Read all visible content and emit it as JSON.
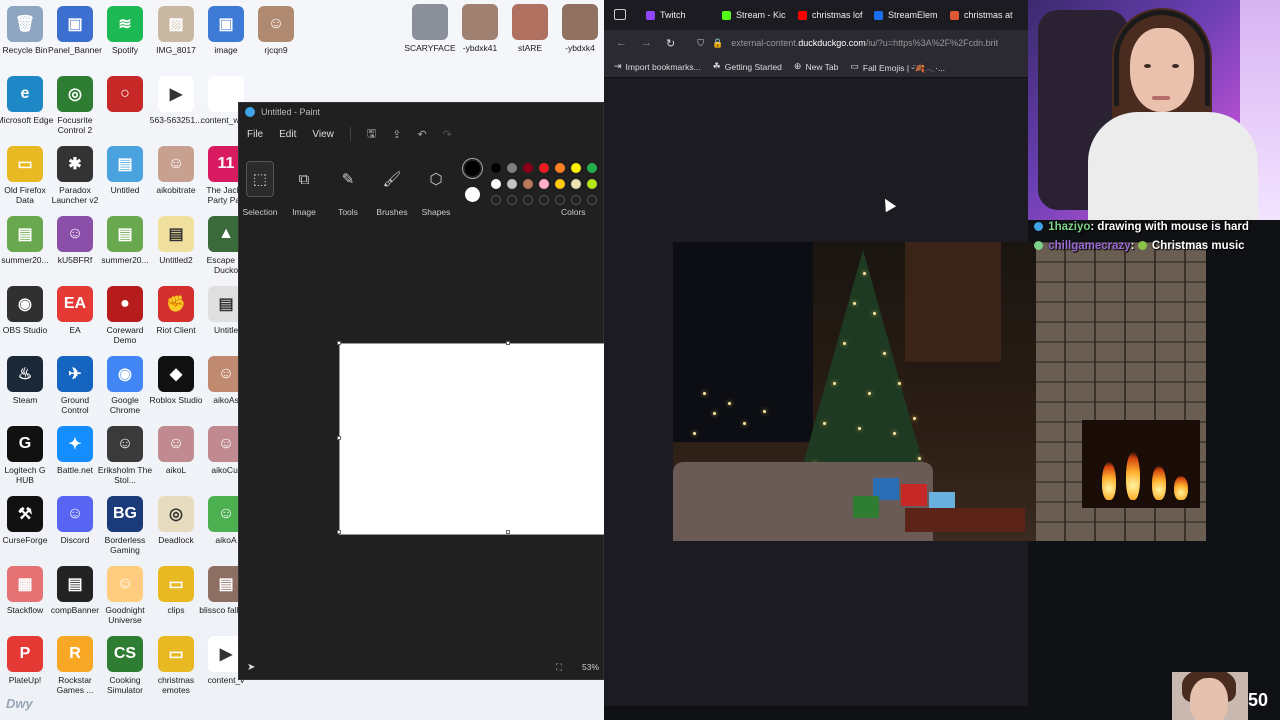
{
  "desktop": {
    "icons": [
      {
        "label": "Recycle Bin",
        "color": "#8ea6c2",
        "glyph": "🗑"
      },
      {
        "label": "Panel_Banner",
        "color": "#3c6fd0",
        "glyph": "▣"
      },
      {
        "label": "Spotify",
        "color": "#1db954",
        "glyph": "≋"
      },
      {
        "label": "IMG_8017",
        "color": "#c9b9a4",
        "glyph": "▨"
      },
      {
        "label": "image",
        "color": "#3d7ad6",
        "glyph": "▣"
      },
      {
        "label": "rjcqn9",
        "color": "#b08a70",
        "glyph": "☺"
      },
      {
        "label": "Microsoft Edge",
        "color": "#1e88c6",
        "glyph": "e"
      },
      {
        "label": "Focusrite Control 2",
        "color": "#2e7d32",
        "glyph": "◎"
      },
      {
        "label": "",
        "color": "#c62828",
        "glyph": "○"
      },
      {
        "label": "563-563251...",
        "color": "#ffffff",
        "glyph": "▶"
      },
      {
        "label": "content_wa...",
        "color": "#ffffff",
        "glyph": ""
      },
      {
        "label": "Old Firefox Data",
        "color": "#e8b923",
        "glyph": "▭"
      },
      {
        "label": "Paradox Launcher v2",
        "color": "#333333",
        "glyph": "✱"
      },
      {
        "label": "Untitled",
        "color": "#4aa3df",
        "glyph": "▤"
      },
      {
        "label": "aikobitrate",
        "color": "#c8a090",
        "glyph": "☺"
      },
      {
        "label": "The Jackb Party Pac",
        "color": "#d81b60",
        "glyph": "11"
      },
      {
        "label": "summer20...",
        "color": "#6aa84f",
        "glyph": "▤"
      },
      {
        "label": "kU5BFRf",
        "color": "#8a4fa8",
        "glyph": "☺"
      },
      {
        "label": "summer20...",
        "color": "#6aa84f",
        "glyph": "▤"
      },
      {
        "label": "Untitled2",
        "color": "#f0e0a0",
        "glyph": "▤"
      },
      {
        "label": "Escape Fr Ducko",
        "color": "#3a6a3a",
        "glyph": "▲"
      },
      {
        "label": "OBS Studio",
        "color": "#303030",
        "glyph": "◉"
      },
      {
        "label": "EA",
        "color": "#e53935",
        "glyph": "EA"
      },
      {
        "label": "Coreward Demo",
        "color": "#b71c1c",
        "glyph": "●"
      },
      {
        "label": "Riot Client",
        "color": "#d32f2f",
        "glyph": "✊"
      },
      {
        "label": "Untitle",
        "color": "#e0e0e0",
        "glyph": "▤"
      },
      {
        "label": "Steam",
        "color": "#1b2838",
        "glyph": "♨"
      },
      {
        "label": "Ground Control",
        "color": "#1565c0",
        "glyph": "✈"
      },
      {
        "label": "Google Chrome",
        "color": "#4285f4",
        "glyph": "◉"
      },
      {
        "label": "Roblox Studio",
        "color": "#111111",
        "glyph": "◆"
      },
      {
        "label": "aikoAs",
        "color": "#c08a70",
        "glyph": "☺"
      },
      {
        "label": "Logitech G HUB",
        "color": "#111111",
        "glyph": "G"
      },
      {
        "label": "Battle.net",
        "color": "#148eff",
        "glyph": "✦"
      },
      {
        "label": "Eriksholm The Stol...",
        "color": "#3a3a3a",
        "glyph": "☺"
      },
      {
        "label": "aikoL",
        "color": "#c08a90",
        "glyph": "☺"
      },
      {
        "label": "aikoCur",
        "color": "#c08a90",
        "glyph": "☺"
      },
      {
        "label": "CurseForge",
        "color": "#111111",
        "glyph": "⚒"
      },
      {
        "label": "Discord",
        "color": "#5865f2",
        "glyph": "☺"
      },
      {
        "label": "Borderless Gaming",
        "color": "#1a3a7a",
        "glyph": "BG"
      },
      {
        "label": "Deadlock",
        "color": "#e8dcc0",
        "glyph": "◎"
      },
      {
        "label": "aikoA",
        "color": "#4caf50",
        "glyph": "☺"
      },
      {
        "label": "Stackflow",
        "color": "#e57373",
        "glyph": "▦"
      },
      {
        "label": "compBanner",
        "color": "#222222",
        "glyph": "▤"
      },
      {
        "label": "Goodnight Universe",
        "color": "#ffcc80",
        "glyph": "☺"
      },
      {
        "label": "clips",
        "color": "#e8b923",
        "glyph": "▭"
      },
      {
        "label": "blissco fall202",
        "color": "#8d6e63",
        "glyph": "▤"
      },
      {
        "label": "PlateUp!",
        "color": "#e53935",
        "glyph": "P"
      },
      {
        "label": "Rockstar Games ...",
        "color": "#f9a825",
        "glyph": "R"
      },
      {
        "label": "Cooking Simulator",
        "color": "#2e7d32",
        "glyph": "CS"
      },
      {
        "label": "christmas emotes",
        "color": "#e8b923",
        "glyph": "▭"
      },
      {
        "label": "content_v",
        "color": "#ffffff",
        "glyph": "▶"
      }
    ],
    "top_icons": [
      {
        "label": "SCARYFACE",
        "color": "#8a8f99"
      },
      {
        "label": "-ybdxk41",
        "color": "#a08070"
      },
      {
        "label": "stARE",
        "color": "#b07060"
      },
      {
        "label": "-ybdxk4",
        "color": "#907060"
      }
    ],
    "extra_icon": {
      "label": "",
      "color": "#5a4020",
      "glyph": "§"
    },
    "brand": "Dwy"
  },
  "paint": {
    "title": "Untitled - Paint",
    "menu": [
      "File",
      "Edit",
      "View"
    ],
    "ribbon": [
      {
        "label": "Selection",
        "glyph": "⬚"
      },
      {
        "label": "Image",
        "glyph": "⧉"
      },
      {
        "label": "Tools",
        "glyph": "✎"
      },
      {
        "label": "Brushes",
        "glyph": "🖌"
      },
      {
        "label": "Shapes",
        "glyph": "⬡"
      }
    ],
    "colors_label": "Colors",
    "palette_row1": [
      "#000000",
      "#7f7f7f",
      "#880015",
      "#ed1c24",
      "#ff7f27",
      "#fff200",
      "#22b14c"
    ],
    "palette_row2": [
      "#ffffff",
      "#c3c3c3",
      "#b97a57",
      "#ffaec9",
      "#ffc90e",
      "#efe4b0",
      "#b5e61d"
    ],
    "primary_color": "#000000",
    "secondary_color": "#ffffff",
    "zoom": "53%"
  },
  "browser": {
    "tabs": [
      {
        "label": "Twitch",
        "color": "#9146ff"
      },
      {
        "label": "Stream - Kic",
        "color": "#53fc18"
      },
      {
        "label": "christmas lof",
        "color": "#ff0000"
      },
      {
        "label": "StreamElem",
        "color": "#1b6ff2"
      },
      {
        "label": "christmas at",
        "color": "#de5833"
      }
    ],
    "url_prefix": "external-content.",
    "url_host": "duckduckgo.com",
    "url_rest": "/iu/?u=https%3A%2F%2Fcdn.brit",
    "bookmarks": [
      {
        "label": "Import bookmarks...",
        "icon": "⇥"
      },
      {
        "label": "Getting Started",
        "icon": "☘"
      },
      {
        "label": "New Tab",
        "icon": "⊕"
      },
      {
        "label": "Fall Emojis | ᵕ̈🍂𓂃·...",
        "icon": "▭"
      }
    ]
  },
  "chat": [
    {
      "user": "1haziyo",
      "message": "drawing with mouse is hard",
      "color": "#7fd18a"
    },
    {
      "user": "chillgamecrazy",
      "message": "Christmas music",
      "color": "#9b6bd8"
    }
  ],
  "overlay_counter": "50"
}
